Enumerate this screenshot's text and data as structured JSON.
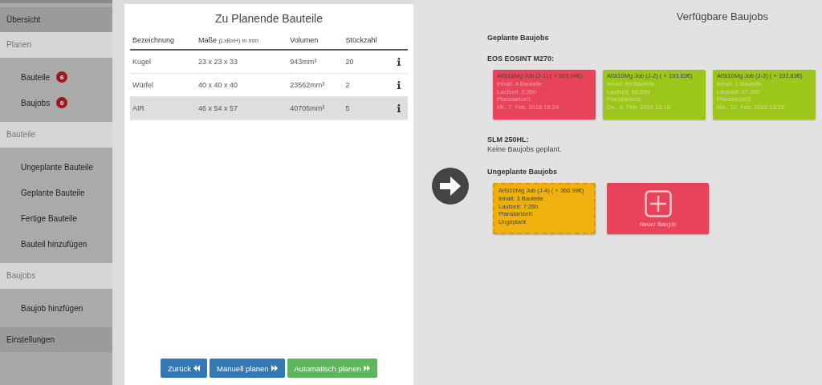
{
  "sidebar": {
    "items": [
      {
        "kind": "link",
        "label": "Übersicht"
      },
      {
        "kind": "group",
        "label": "Planen",
        "children": [
          {
            "label": "Bauteile",
            "badge": "6"
          },
          {
            "label": "Baujobs",
            "badge": "0"
          }
        ]
      },
      {
        "kind": "group",
        "label": "Bauteile",
        "children": [
          {
            "label": "Ungeplante Bauteile"
          },
          {
            "label": "Geplante Bauteile"
          },
          {
            "label": "Fertige Bauteile"
          },
          {
            "label": "Bauteil hinzufügen"
          }
        ]
      },
      {
        "kind": "group",
        "label": "Baujobs",
        "children": [
          {
            "label": "Baujob hinzfügen"
          }
        ]
      },
      {
        "kind": "link",
        "label": "Einstellungen"
      }
    ]
  },
  "parts_panel": {
    "title": "Zu Planende Bauteile",
    "table": {
      "columns": [
        {
          "label": "Bezeichnung"
        },
        {
          "label": "Maße",
          "unit": "(LxBxH) in mm"
        },
        {
          "label": "Volumen"
        },
        {
          "label": "Stückzahl"
        }
      ],
      "rows": [
        {
          "cells": [
            "Kugel",
            "23 x 23 x 33",
            "943mm³",
            "20"
          ],
          "selected": false
        },
        {
          "cells": [
            "Würfel",
            "40 x 40 x 40",
            "23562mm³",
            "2"
          ],
          "selected": false
        },
        {
          "cells": [
            "AIR",
            "46 x 54 x 57",
            "40705mm³",
            "5"
          ],
          "selected": true
        }
      ]
    },
    "buttons": [
      {
        "label": "Zurück",
        "kind": "back"
      },
      {
        "label": "Manuell planen",
        "kind": "forward"
      },
      {
        "label": "Automatisch planen",
        "kind": "auto"
      }
    ]
  },
  "jobs_panel": {
    "title": "Verfügbare Baujobs",
    "planned_heading": "Geplante Baujobs",
    "machines": [
      {
        "name": "EOS EOSINT M270:",
        "jobs": [
          {
            "title": "AlSi10Mg Job (J-1) ( + 529.94€)",
            "lines": [
              "Inhalt: 4 Bauteile",
              "Laufzeit: 2:35h",
              "Planstartzeit:",
              "Mi., 7. Feb. 2018 16:24"
            ],
            "color": "#e8435a",
            "kind": "planned"
          },
          {
            "title": "AlSi10Mg Job (J-2) ( + 193.83€)",
            "lines": [
              "Inhalt: 69 Bauteile",
              "Laufzeit: 66:55h",
              "Planstartzeit:",
              "Do., 8. Feb. 2018 13:15"
            ],
            "color": "#9cc61a",
            "kind": "planned"
          },
          {
            "title": "AlSi10Mg Job (J-3) ( + 193.83€)",
            "lines": [
              "Inhalt: 1 Bauteile",
              "Laufzeit: 37:26h",
              "Planstartzeit:",
              "Mo., 12. Feb. 2018 13:15"
            ],
            "color": "#9cc61a",
            "kind": "planned"
          }
        ]
      },
      {
        "name": "SLM 250HL:",
        "empty_text": "Keine Baujobs geplant."
      }
    ],
    "unplanned_heading": "Ungeplante Baujobs",
    "unplanned": [
      {
        "title": "AlSi10Mg Job (J-4) ( + 366.98€)",
        "lines": [
          "Inhalt: 3 Bauteile",
          "Laufzeit: 7:26h",
          "Planstartzeit:",
          "Ungeplant"
        ],
        "color": "#efb10e",
        "kind": "unplanned"
      }
    ],
    "new_job_label": "Neuer Baujob"
  }
}
